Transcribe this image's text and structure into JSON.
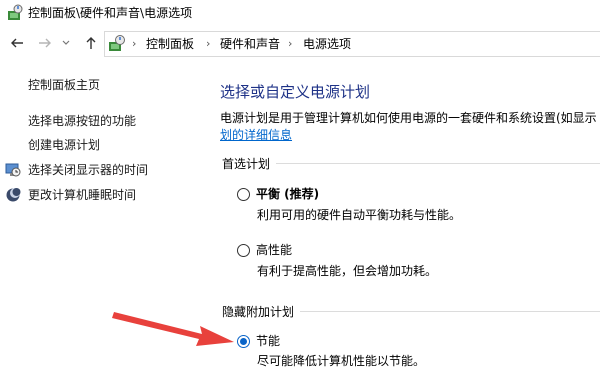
{
  "window": {
    "title": "控制面板\\硬件和声音\\电源选项"
  },
  "toolbar": {
    "back_icon": "back-arrow-icon",
    "forward_icon": "forward-arrow-icon",
    "recent_icon": "chevron-down-icon",
    "up_icon": "up-arrow-icon",
    "breadcrumbs": [
      "控制面板",
      "硬件和声音",
      "电源选项"
    ]
  },
  "sidebar": {
    "items": [
      {
        "label": "控制面板主页"
      },
      {
        "label": "选择电源按钮的功能"
      },
      {
        "label": "创建电源计划"
      },
      {
        "label": "选择关闭显示器的时间",
        "icon": "monitor-clock-icon"
      },
      {
        "label": "更改计算机睡眠时间",
        "icon": "moon-icon"
      }
    ]
  },
  "main": {
    "heading": "选择或自定义电源计划",
    "description": "电源计划是用于管理计算机如何使用电源的一套硬件和系统设置(如显示",
    "description_link": "划的详细信息",
    "preferred_group": {
      "label": "首选计划",
      "plans": [
        {
          "name": "平衡 (推荐)",
          "desc": "利用可用的硬件自动平衡功耗与性能。",
          "selected": false
        },
        {
          "name": "高性能",
          "desc": "有利于提高性能，但会增加功耗。",
          "selected": false
        }
      ]
    },
    "hidden_group": {
      "label": "隐藏附加计划",
      "plans": [
        {
          "name": "节能",
          "desc": "尽可能降低计算机性能以节能。",
          "selected": true
        }
      ]
    }
  },
  "colors": {
    "heading": "#1e3287",
    "link": "#0066cc",
    "radio_selected": "#0a64c8",
    "annotation_arrow": "#e8413c"
  }
}
